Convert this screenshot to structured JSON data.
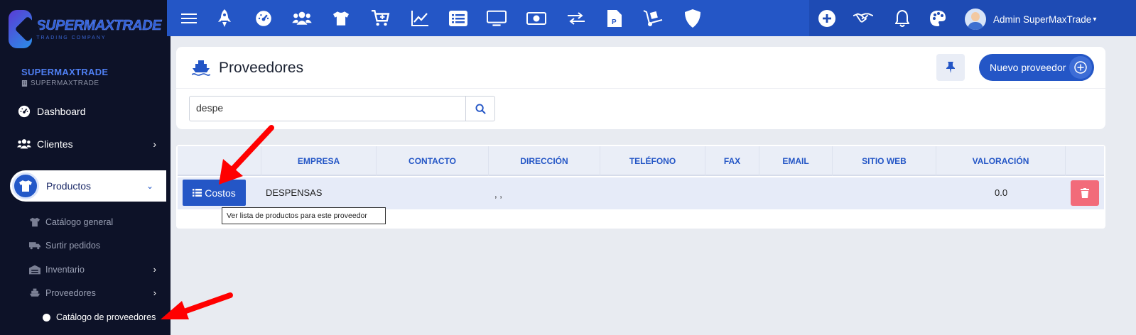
{
  "brand": {
    "logo_text": "SUPERMAXTRADE",
    "logo_sub": "TRADING COMPANY"
  },
  "company": {
    "name": "SUPERMAXTRADE",
    "sub": "SUPERMAXTRADE"
  },
  "sidebar": {
    "dashboard": "Dashboard",
    "clientes": "Clientes",
    "productos": "Productos",
    "sub_items": {
      "catalogo_general": "Catálogo general",
      "surtir_pedidos": "Surtir pedidos",
      "inventario": "Inventario",
      "proveedores": "Proveedores",
      "catalogo_proveedores": "Catálogo de proveedores"
    }
  },
  "topbar": {
    "user_name": "Admin SuperMaxTrade",
    "icons": [
      "menu-icon",
      "rocket-icon",
      "dashboard-gauge-icon",
      "users-icon",
      "tshirt-icon",
      "cart-plus-icon",
      "chart-line-icon",
      "list-icon",
      "monitor-icon",
      "money-bill-icon",
      "exchange-icon",
      "file-p-icon",
      "dolly-icon",
      "shield-icon",
      "plus-circle-icon",
      "handshake-icon",
      "bell-icon",
      "palette-icon"
    ]
  },
  "page": {
    "title": "Proveedores",
    "new_button": "Nuevo proveedor",
    "search_value": "despe"
  },
  "table": {
    "headers": [
      "EMPRESA",
      "CONTACTO",
      "DIRECCIÓN",
      "TELÉFONO",
      "FAX",
      "EMAIL",
      "SITIO WEB",
      "VALORACIÓN"
    ],
    "rows": [
      {
        "costos_label": "Costos",
        "empresa": "DESPENSAS",
        "contacto": "",
        "direccion": ", ,",
        "telefono": "",
        "fax": "",
        "email": "",
        "sitio_web": "",
        "valoracion": "0.0"
      }
    ]
  },
  "tooltip": "Ver lista de productos para este proveedor",
  "colors": {
    "primary": "#2456c6",
    "sidebar": "#0d1228",
    "danger": "#f26b7a",
    "annotation": "#ff0000"
  }
}
